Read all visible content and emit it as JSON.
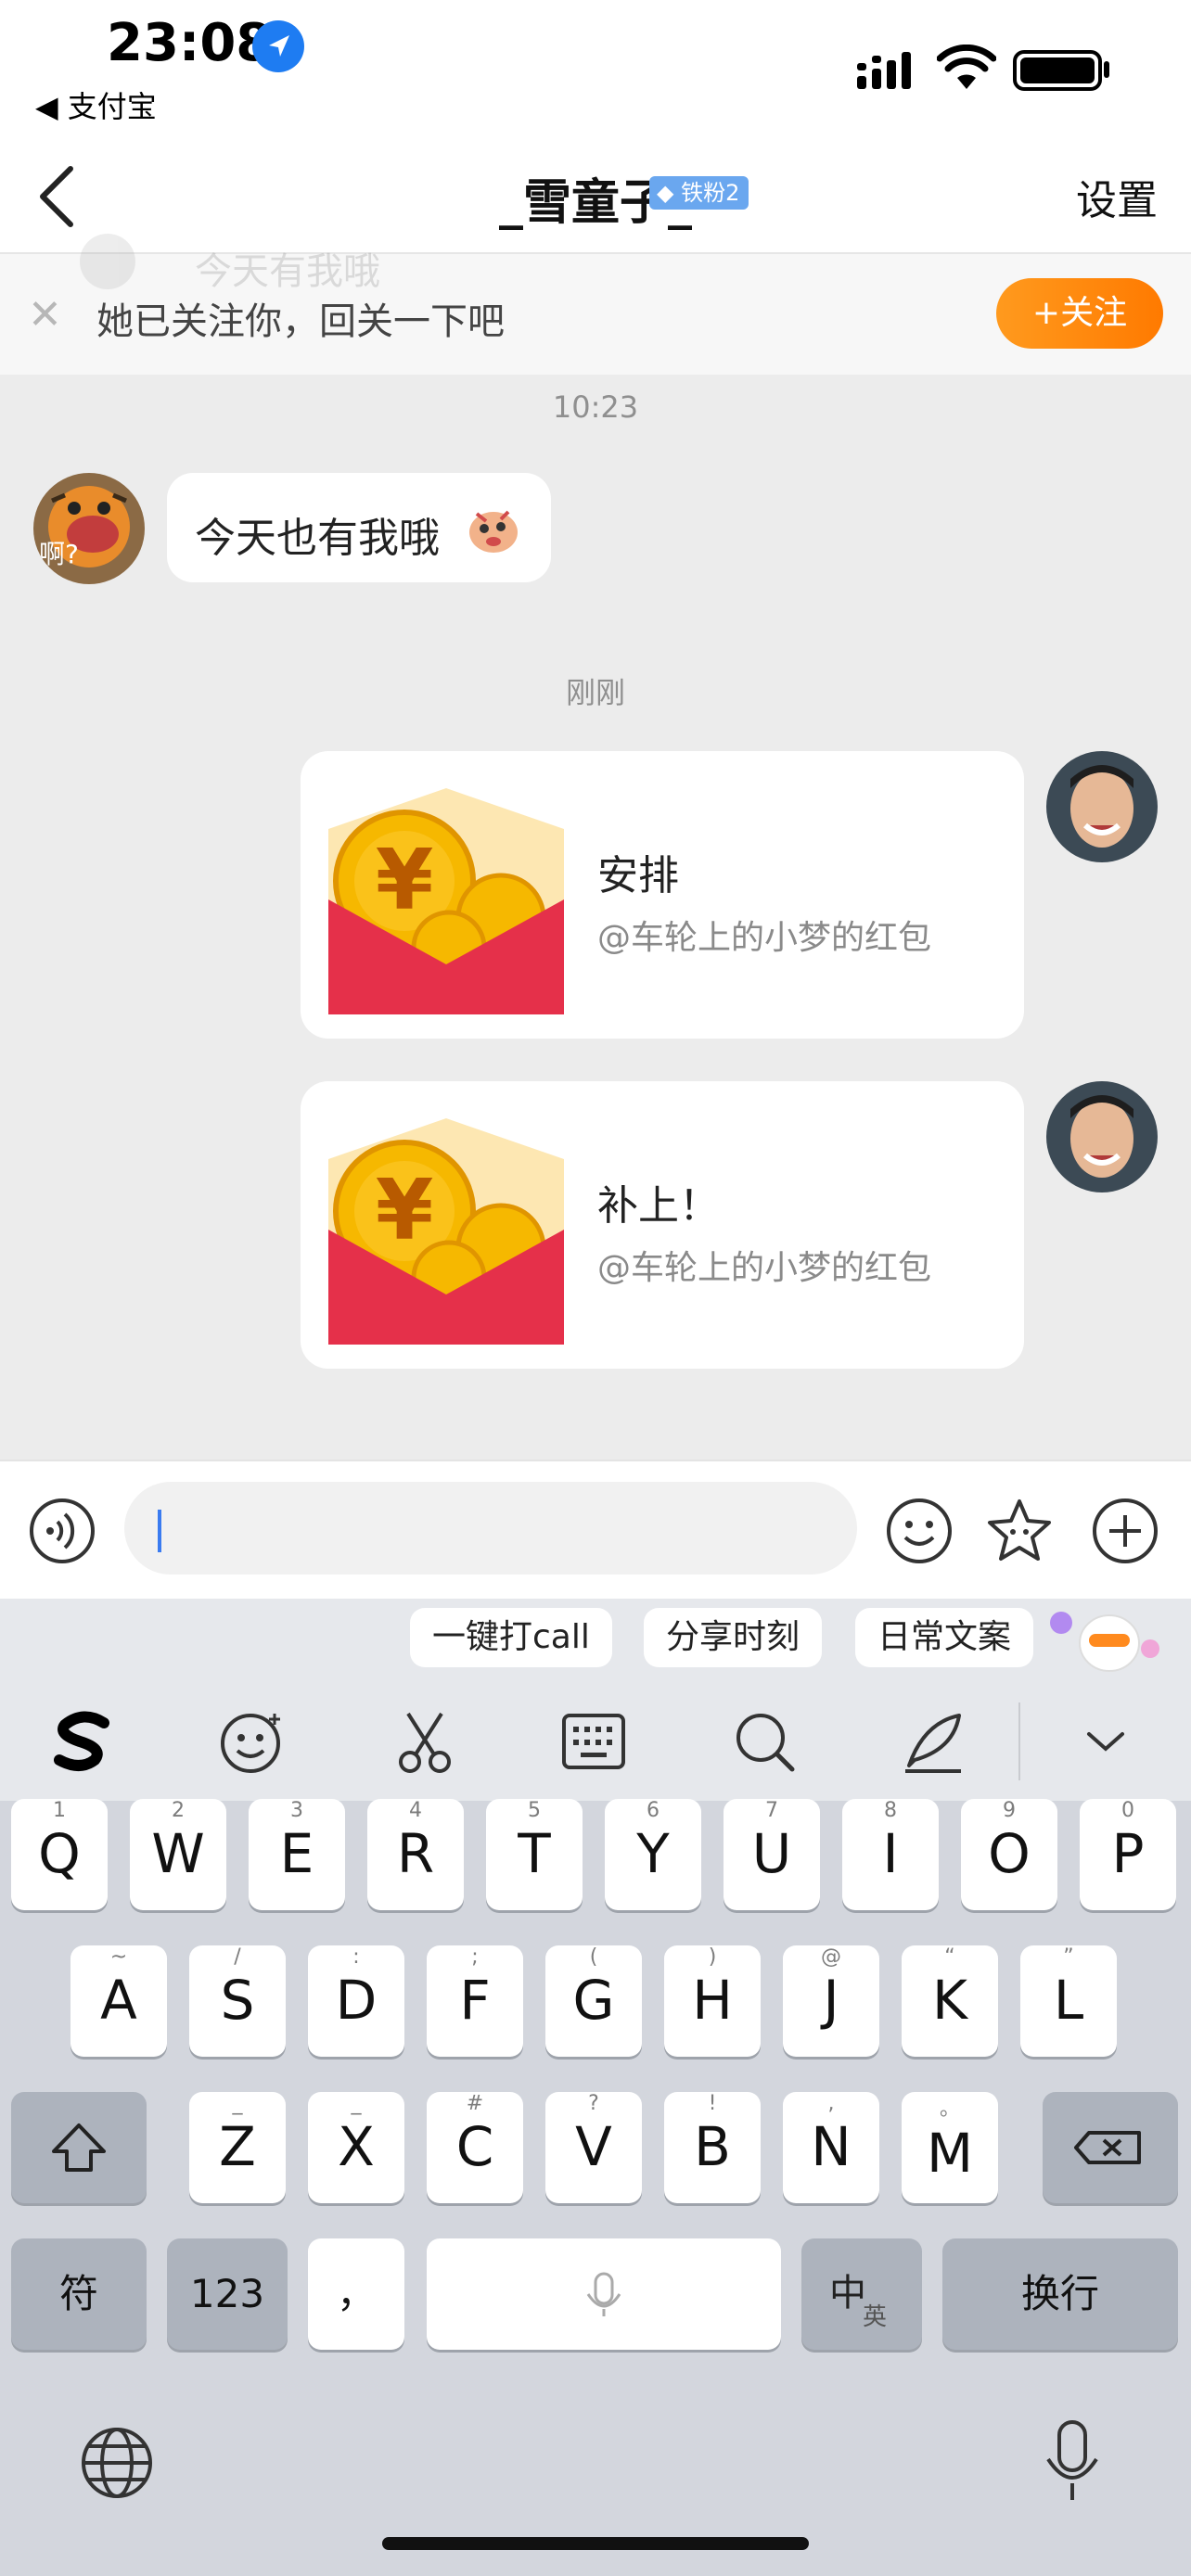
{
  "status_bar": {
    "time": "23:08",
    "back_app": "◀ 支付宝"
  },
  "nav": {
    "title": "_雪童子_",
    "fan_badge": "铁粉2",
    "settings": "设置"
  },
  "follow_banner": {
    "text": "她已关注你，回关一下吧",
    "button": "+关注",
    "ghost_text": "今天有我哦"
  },
  "chat": {
    "timestamp_1": "10:23",
    "incoming_message": "今天也有我哦",
    "avatar_caption": "啊?",
    "timestamp_2": "刚刚",
    "red_packets": [
      {
        "title": "安排",
        "subtitle": "@车轮上的小梦的红包"
      },
      {
        "title": "补上！",
        "subtitle": "@车轮上的小梦的红包"
      }
    ]
  },
  "input_bar": {
    "value": ""
  },
  "keyboard": {
    "suggestions": [
      "一键打call",
      "分享时刻",
      "日常文案"
    ],
    "row1": [
      {
        "letter": "Q",
        "hint": "1"
      },
      {
        "letter": "W",
        "hint": "2"
      },
      {
        "letter": "E",
        "hint": "3"
      },
      {
        "letter": "R",
        "hint": "4"
      },
      {
        "letter": "T",
        "hint": "5"
      },
      {
        "letter": "Y",
        "hint": "6"
      },
      {
        "letter": "U",
        "hint": "7"
      },
      {
        "letter": "I",
        "hint": "8"
      },
      {
        "letter": "O",
        "hint": "9"
      },
      {
        "letter": "P",
        "hint": "0"
      }
    ],
    "row2": [
      {
        "letter": "A",
        "hint": "~"
      },
      {
        "letter": "S",
        "hint": "/"
      },
      {
        "letter": "D",
        "hint": ":"
      },
      {
        "letter": "F",
        "hint": ";"
      },
      {
        "letter": "G",
        "hint": "("
      },
      {
        "letter": "H",
        "hint": ")"
      },
      {
        "letter": "J",
        "hint": "@"
      },
      {
        "letter": "K",
        "hint": "“"
      },
      {
        "letter": "L",
        "hint": "”"
      }
    ],
    "row3": [
      {
        "letter": "Z",
        "hint": "_"
      },
      {
        "letter": "X",
        "hint": "_"
      },
      {
        "letter": "C",
        "hint": "#"
      },
      {
        "letter": "V",
        "hint": "?"
      },
      {
        "letter": "B",
        "hint": "!"
      },
      {
        "letter": "N",
        "hint": ","
      },
      {
        "letter": "M",
        "hint": "。"
      }
    ],
    "symbols_key": "符",
    "numbers_key": "123",
    "punct_key": "，",
    "lang_key_main": "中",
    "lang_key_sub": "英",
    "return_key": "换行"
  },
  "colors": {
    "accent_orange": "#ff8a10",
    "red_packet": "#e5304a",
    "coin_gold": "#f6b800",
    "badge_blue": "#6aa7ef"
  }
}
